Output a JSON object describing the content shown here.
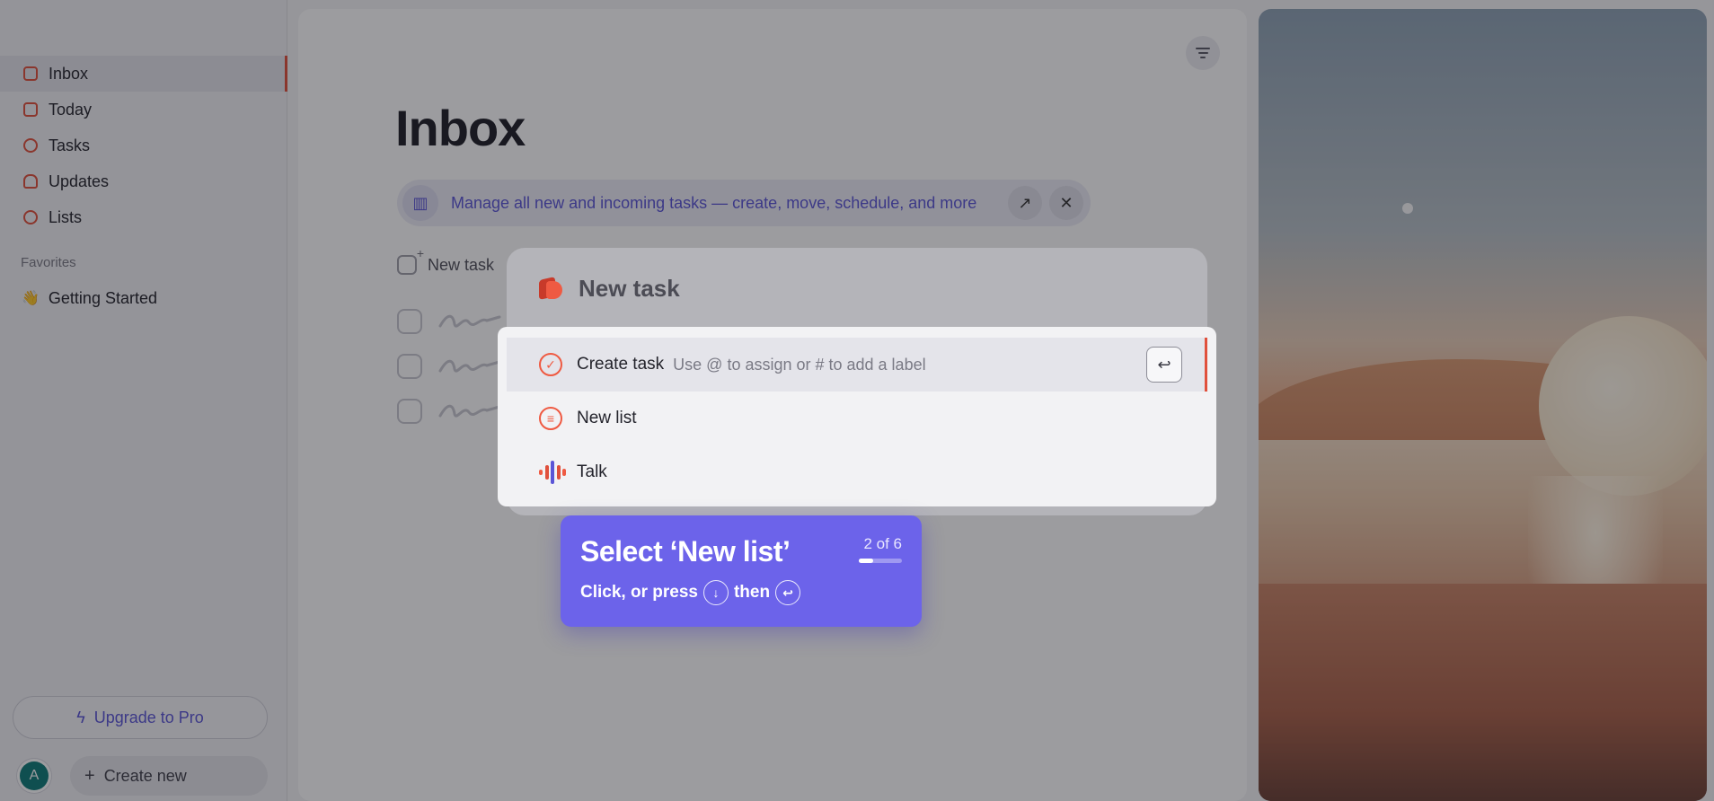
{
  "sidebar": {
    "items": [
      {
        "label": "Inbox",
        "icon": "inbox-icon",
        "active": true
      },
      {
        "label": "Today",
        "icon": "calendar-icon",
        "active": false
      },
      {
        "label": "Tasks",
        "icon": "check-circle-icon",
        "active": false
      },
      {
        "label": "Updates",
        "icon": "bell-icon",
        "active": false
      },
      {
        "label": "Lists",
        "icon": "list-icon",
        "active": false
      }
    ],
    "favorites_label": "Favorites",
    "favorites": [
      {
        "label": "Getting Started",
        "emoji": "👋"
      }
    ],
    "upgrade_label": "Upgrade to Pro",
    "avatar_initial": "A",
    "create_new_label": "Create new"
  },
  "main": {
    "title": "Inbox",
    "banner_text": "Manage all new and incoming tasks — create, move, schedule, and more",
    "new_task_label": "New task"
  },
  "dialog": {
    "title": "New task",
    "items": [
      {
        "label": "Create task",
        "hint": "Use @ to assign or # to add a label",
        "icon": "check-circle-icon",
        "selected": true
      },
      {
        "label": "New list",
        "icon": "list-icon",
        "selected": false
      },
      {
        "label": "Talk",
        "icon": "voice-icon",
        "selected": false
      }
    ],
    "enter_key": "↩"
  },
  "tooltip": {
    "title": "Select ‘New list’",
    "step": "2 of 6",
    "progress": 0.333,
    "sub_prefix": "Click, or press",
    "sub_middle": "then",
    "down_key": "↓",
    "enter_key": "↩"
  },
  "colors": {
    "accent": "#e0503c",
    "brand_purple": "#6c63ea",
    "overlay": "rgba(18,18,26,0.42)"
  }
}
